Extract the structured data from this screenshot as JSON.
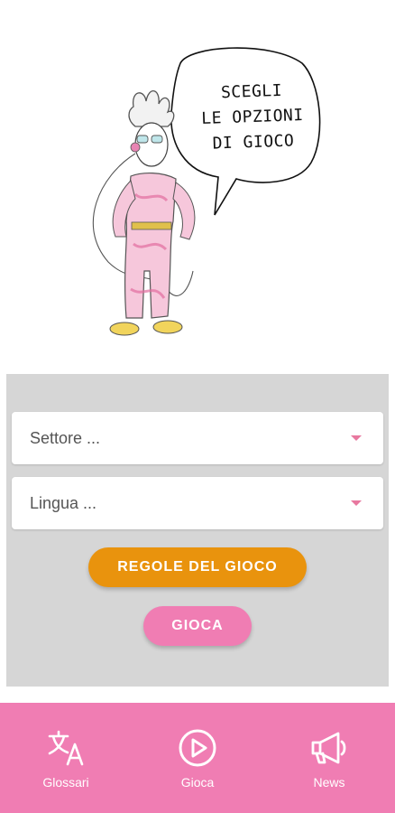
{
  "hero": {
    "speech_lines": [
      "SCEGLI",
      "LE OPZIONI",
      "DI GIOCO"
    ]
  },
  "form": {
    "sector_select": {
      "value": "Settore ..."
    },
    "language_select": {
      "value": "Lingua ..."
    },
    "rules_button": "REGOLE DEL GIOCO",
    "play_button": "GIOCA"
  },
  "bottom_nav": {
    "items": [
      {
        "label": "Glossari",
        "icon": "translate-icon"
      },
      {
        "label": "Gioca",
        "icon": "play-circle-icon"
      },
      {
        "label": "News",
        "icon": "megaphone-icon"
      }
    ]
  },
  "colors": {
    "accent_pink": "#f07db3",
    "rules_orange": "#e9930d",
    "panel_gray": "#d6d6d6"
  }
}
